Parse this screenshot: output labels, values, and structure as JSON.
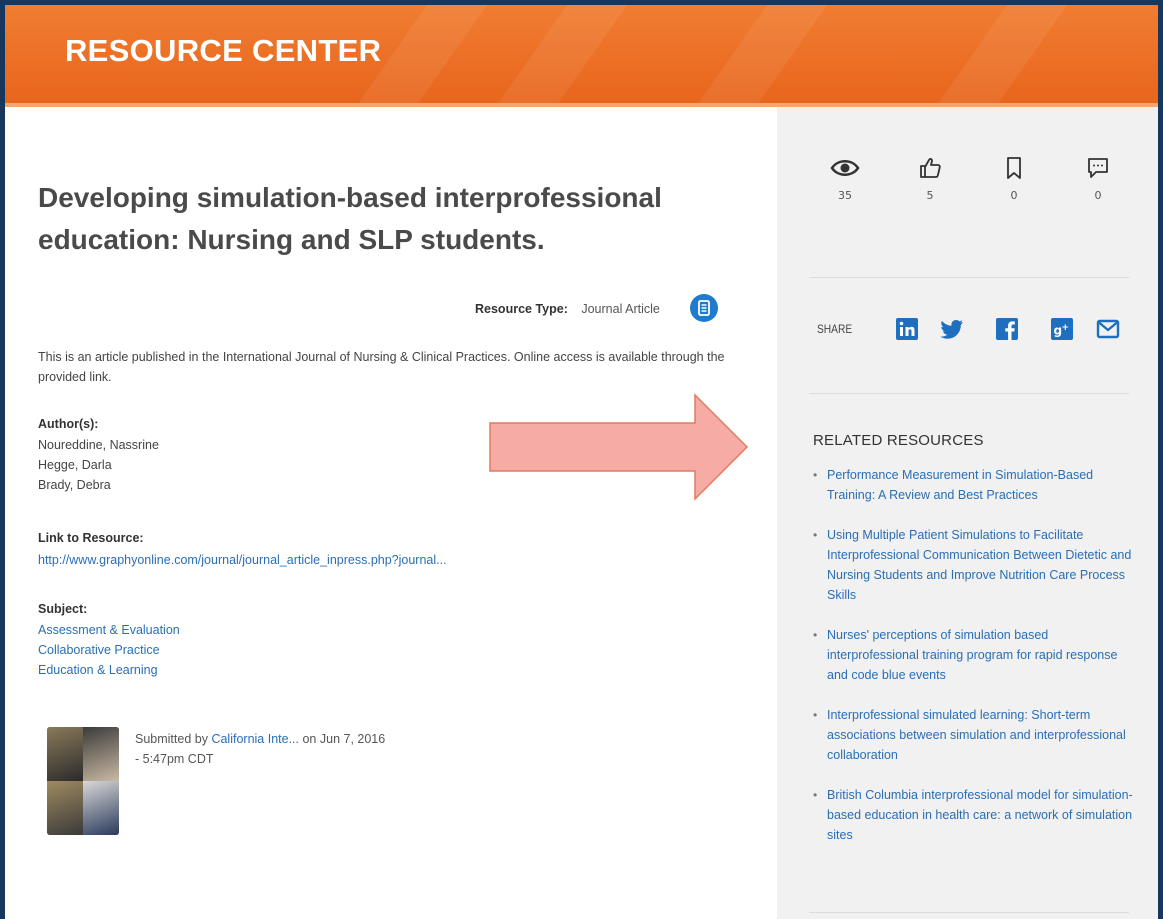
{
  "banner": {
    "title": "RESOURCE CENTER"
  },
  "article": {
    "title": "Developing simulation-based interprofessional education: Nursing and SLP students.",
    "resource_type_label": "Resource Type:",
    "resource_type_value": "Journal Article",
    "description": "This is an article published in the International Journal of Nursing & Clinical Practices.  Online access is available through the provided link.",
    "authors_label": "Author(s):",
    "authors": [
      "Noureddine, Nassrine",
      "Hegge, Darla",
      "Brady, Debra"
    ],
    "link_label": "Link to Resource:",
    "link_text": "http://www.graphyonline.com/journal/journal_article_inpress.php?journal...",
    "subject_label": "Subject:",
    "subjects": [
      "Assessment & Evaluation",
      "Collaborative Practice",
      "Education & Learning"
    ],
    "submitted_prefix": "Submitted by",
    "submitted_by": "California Inte...",
    "submitted_on": "on Jun 7, 2016",
    "submitted_time": "- 5:47pm CDT"
  },
  "stats": {
    "views": "35",
    "likes": "5",
    "bookmarks": "0",
    "comments": "0"
  },
  "share": {
    "label": "SHARE"
  },
  "related": {
    "heading": "RELATED RESOURCES",
    "items": [
      "Performance Measurement in Simulation-Based Training: A Review and Best Practices",
      "Using Multiple Patient Simulations to Facilitate Interprofessional Communication Between Dietetic and Nursing Students and Improve Nutrition Care Process Skills",
      "Nurses' perceptions of simulation based interprofessional training program for rapid response and code blue events",
      "Interprofessional simulated learning: Short-term associations between simulation and interprofessional collaboration",
      "British Columbia interprofessional model for simulation-based education in health care: a network of simulation sites"
    ]
  },
  "colors": {
    "banner": "#e8651c",
    "link": "#2a6eb5",
    "frame": "#17375e",
    "arrow_fill": "#f4a6a0",
    "arrow_stroke": "#e0735a"
  }
}
